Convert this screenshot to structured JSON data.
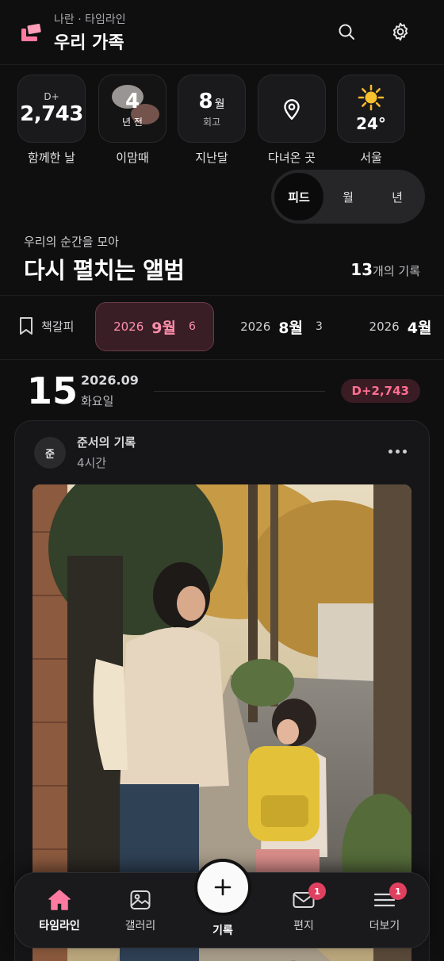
{
  "header": {
    "subtitle": "나란 · 타임라인",
    "title": "우리 가족",
    "accent_color": "#ff7aa0"
  },
  "stats": [
    {
      "top": "D+",
      "value": "2,743",
      "caption": "함께한 날"
    },
    {
      "value": "4",
      "sub": "년 전",
      "caption": "이맘때"
    },
    {
      "value": "8",
      "unit": "월",
      "sub": "회고",
      "caption": "지난달"
    },
    {
      "icon": "location-pin-icon",
      "caption": "다녀온 곳"
    },
    {
      "icon": "sun-icon",
      "temp": "24°",
      "caption": "서울"
    }
  ],
  "view_toggle": {
    "options": [
      "피드",
      "월",
      "년"
    ],
    "active": "피드"
  },
  "section": {
    "subtitle": "우리의 순간을 모아",
    "title": "다시 펼치는 앨범",
    "count_num": "13",
    "count_suffix": "개의 기록"
  },
  "month_strip": {
    "bookmark_label": "책갈피",
    "chips": [
      {
        "year": "2026",
        "month": "9월",
        "count": "6",
        "active": true
      },
      {
        "year": "2026",
        "month": "8월",
        "count": "3",
        "active": false
      },
      {
        "year": "2026",
        "month": "4월",
        "count": "",
        "active": false
      }
    ]
  },
  "date_row": {
    "day": "15",
    "year_month": "2026.09",
    "weekday": "화요일",
    "dday": "D+2,743"
  },
  "post": {
    "avatar_initial": "준",
    "author": "준서의 기록",
    "ago": "4시간"
  },
  "nav": {
    "items": [
      {
        "label": "타임라인",
        "icon": "home-icon",
        "active": true
      },
      {
        "label": "갤러리",
        "icon": "gallery-icon",
        "active": false
      },
      {
        "label": "기록",
        "icon": "plus-icon",
        "active": false
      },
      {
        "label": "편지",
        "icon": "mail-icon",
        "badge": "1",
        "active": false
      },
      {
        "label": "더보기",
        "icon": "menu-icon",
        "badge": "1",
        "active": false
      }
    ]
  }
}
